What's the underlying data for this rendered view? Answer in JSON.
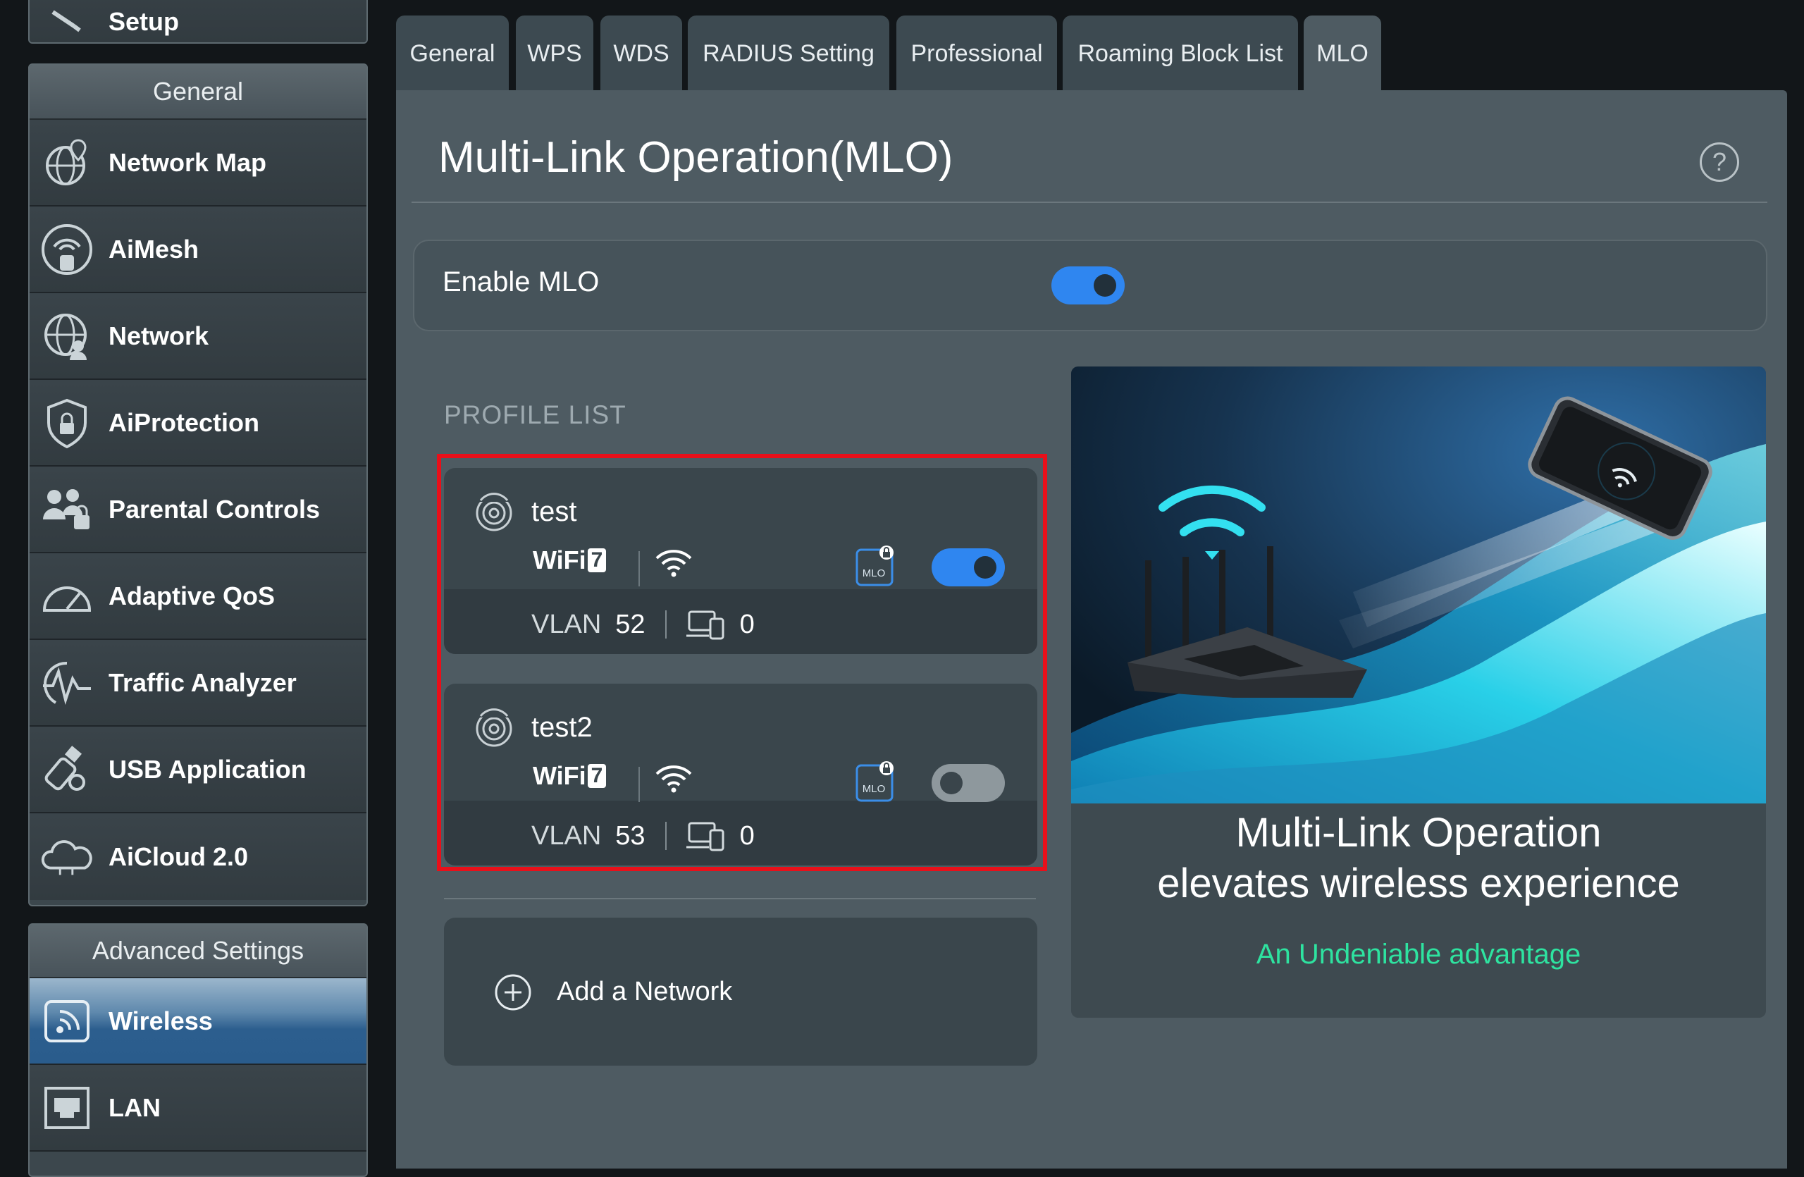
{
  "sidebar": {
    "setup_label": "Setup",
    "general_header": "General",
    "general_items": [
      {
        "label": "Network Map",
        "icon": "network-map-icon"
      },
      {
        "label": "AiMesh",
        "icon": "aimesh-icon"
      },
      {
        "label": "Network",
        "icon": "network-icon"
      },
      {
        "label": "AiProtection",
        "icon": "aiprotection-icon"
      },
      {
        "label": "Parental Controls",
        "icon": "parental-controls-icon"
      },
      {
        "label": "Adaptive QoS",
        "icon": "adaptive-qos-icon"
      },
      {
        "label": "Traffic Analyzer",
        "icon": "traffic-analyzer-icon"
      },
      {
        "label": "USB Application",
        "icon": "usb-icon"
      },
      {
        "label": "AiCloud 2.0",
        "icon": "aicloud-icon"
      }
    ],
    "advanced_header": "Advanced Settings",
    "advanced_items": [
      {
        "label": "Wireless",
        "icon": "wireless-icon",
        "active": true
      },
      {
        "label": "LAN",
        "icon": "lan-icon"
      }
    ]
  },
  "tabs": [
    {
      "label": "General"
    },
    {
      "label": "WPS"
    },
    {
      "label": "WDS"
    },
    {
      "label": "RADIUS Setting"
    },
    {
      "label": "Professional"
    },
    {
      "label": "Roaming Block List"
    },
    {
      "label": "MLO",
      "active": true
    }
  ],
  "main": {
    "title": "Multi-Link Operation(MLO)",
    "enable_label": "Enable MLO",
    "enable_on": true,
    "profile_list_heading": "PROFILE LIST",
    "profiles": [
      {
        "name": "test",
        "wifi_label": "WiFi",
        "wifi_gen": "7",
        "vlan_label": "VLAN",
        "vlan": "52",
        "devices": "0",
        "enabled": true
      },
      {
        "name": "test2",
        "wifi_label": "WiFi",
        "wifi_gen": "7",
        "vlan_label": "VLAN",
        "vlan": "53",
        "devices": "0",
        "enabled": false
      }
    ],
    "add_network_label": "Add a Network",
    "mlo_badge_text": "MLO"
  },
  "promo": {
    "headline": "Multi-Link Operation elevates wireless experience",
    "subline": "An Undeniable advantage"
  },
  "colors": {
    "accent_blue": "#2f86f0",
    "promo_green": "#2ee3a0",
    "highlight_red": "#e8101a"
  }
}
